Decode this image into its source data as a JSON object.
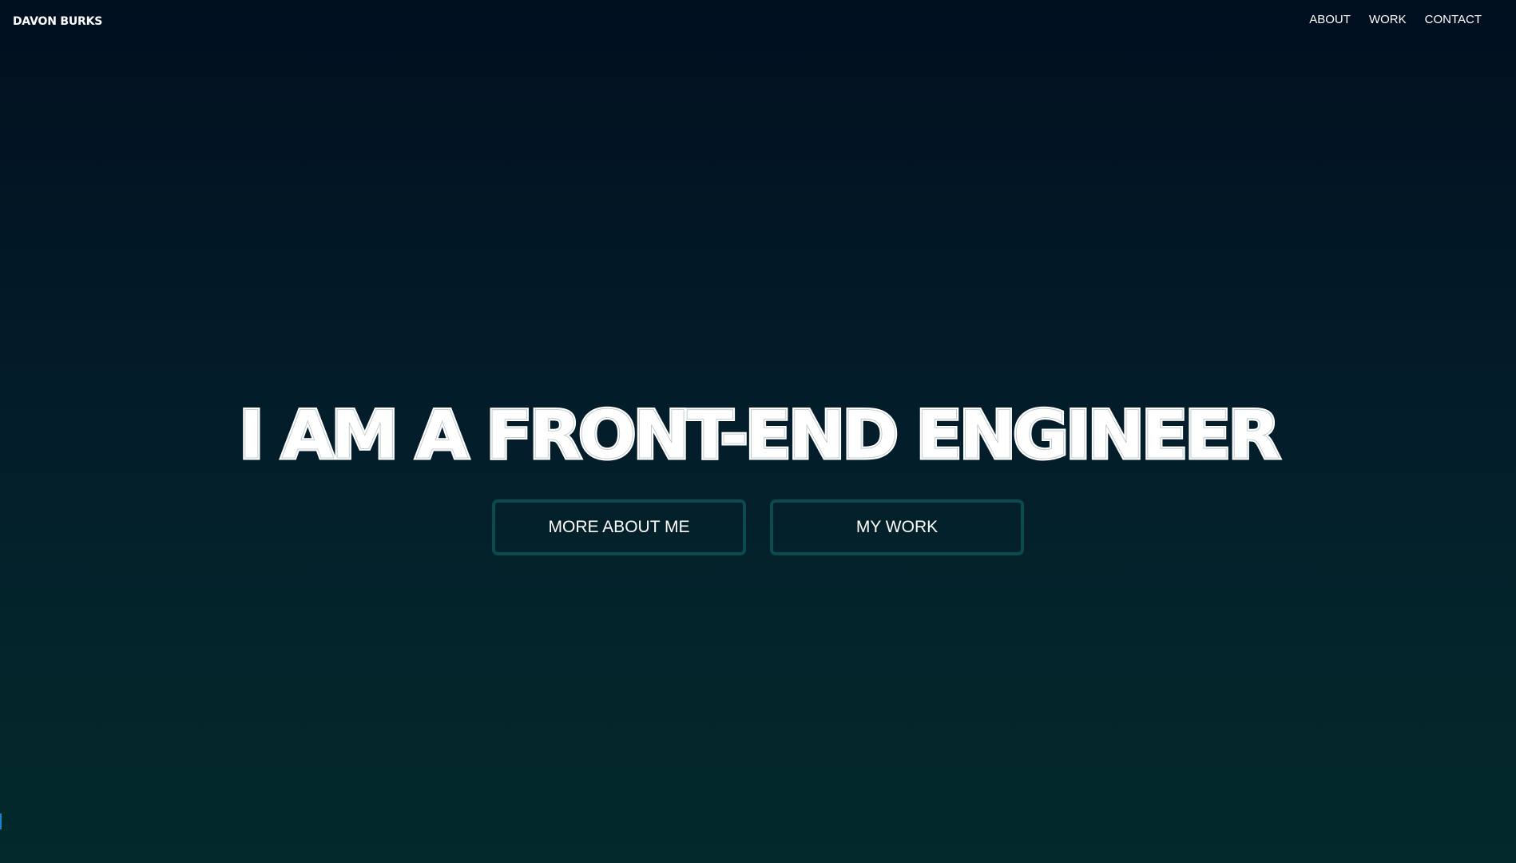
{
  "header": {
    "brand": "DAVON BURKS",
    "nav": [
      {
        "label": "ABOUT"
      },
      {
        "label": "WORK"
      },
      {
        "label": "CONTACT"
      }
    ]
  },
  "hero": {
    "headline": "I AM A FRONT-END ENGINEER",
    "buttons": [
      {
        "label": "MORE ABOUT ME"
      },
      {
        "label": "MY WORK"
      }
    ]
  },
  "colors": {
    "background_top": "#010f1f",
    "background_bottom": "#03292b",
    "text": "#ffffff",
    "button_border": "#0b4a4f"
  }
}
